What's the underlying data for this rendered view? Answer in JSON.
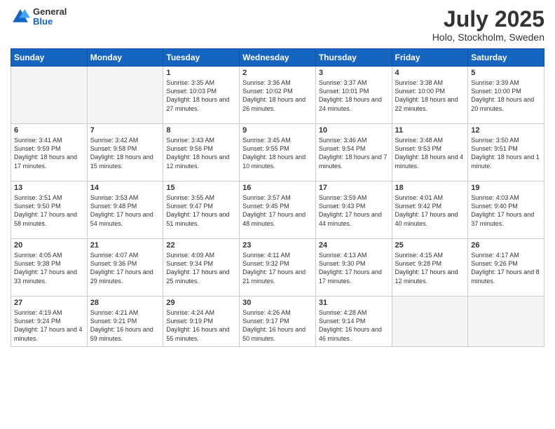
{
  "logo": {
    "general": "General",
    "blue": "Blue"
  },
  "title": "July 2025",
  "location": "Holo, Stockholm, Sweden",
  "days_of_week": [
    "Sunday",
    "Monday",
    "Tuesday",
    "Wednesday",
    "Thursday",
    "Friday",
    "Saturday"
  ],
  "weeks": [
    [
      {
        "day": "",
        "empty": true
      },
      {
        "day": "",
        "empty": true
      },
      {
        "day": "1",
        "sunrise": "Sunrise: 3:35 AM",
        "sunset": "Sunset: 10:03 PM",
        "daylight": "Daylight: 18 hours and 27 minutes."
      },
      {
        "day": "2",
        "sunrise": "Sunrise: 3:36 AM",
        "sunset": "Sunset: 10:02 PM",
        "daylight": "Daylight: 18 hours and 26 minutes."
      },
      {
        "day": "3",
        "sunrise": "Sunrise: 3:37 AM",
        "sunset": "Sunset: 10:01 PM",
        "daylight": "Daylight: 18 hours and 24 minutes."
      },
      {
        "day": "4",
        "sunrise": "Sunrise: 3:38 AM",
        "sunset": "Sunset: 10:00 PM",
        "daylight": "Daylight: 18 hours and 22 minutes."
      },
      {
        "day": "5",
        "sunrise": "Sunrise: 3:39 AM",
        "sunset": "Sunset: 10:00 PM",
        "daylight": "Daylight: 18 hours and 20 minutes."
      }
    ],
    [
      {
        "day": "6",
        "sunrise": "Sunrise: 3:41 AM",
        "sunset": "Sunset: 9:59 PM",
        "daylight": "Daylight: 18 hours and 17 minutes."
      },
      {
        "day": "7",
        "sunrise": "Sunrise: 3:42 AM",
        "sunset": "Sunset: 9:58 PM",
        "daylight": "Daylight: 18 hours and 15 minutes."
      },
      {
        "day": "8",
        "sunrise": "Sunrise: 3:43 AM",
        "sunset": "Sunset: 9:56 PM",
        "daylight": "Daylight: 18 hours and 12 minutes."
      },
      {
        "day": "9",
        "sunrise": "Sunrise: 3:45 AM",
        "sunset": "Sunset: 9:55 PM",
        "daylight": "Daylight: 18 hours and 10 minutes."
      },
      {
        "day": "10",
        "sunrise": "Sunrise: 3:46 AM",
        "sunset": "Sunset: 9:54 PM",
        "daylight": "Daylight: 18 hours and 7 minutes."
      },
      {
        "day": "11",
        "sunrise": "Sunrise: 3:48 AM",
        "sunset": "Sunset: 9:53 PM",
        "daylight": "Daylight: 18 hours and 4 minutes."
      },
      {
        "day": "12",
        "sunrise": "Sunrise: 3:50 AM",
        "sunset": "Sunset: 9:51 PM",
        "daylight": "Daylight: 18 hours and 1 minute."
      }
    ],
    [
      {
        "day": "13",
        "sunrise": "Sunrise: 3:51 AM",
        "sunset": "Sunset: 9:50 PM",
        "daylight": "Daylight: 17 hours and 58 minutes."
      },
      {
        "day": "14",
        "sunrise": "Sunrise: 3:53 AM",
        "sunset": "Sunset: 9:48 PM",
        "daylight": "Daylight: 17 hours and 54 minutes."
      },
      {
        "day": "15",
        "sunrise": "Sunrise: 3:55 AM",
        "sunset": "Sunset: 9:47 PM",
        "daylight": "Daylight: 17 hours and 51 minutes."
      },
      {
        "day": "16",
        "sunrise": "Sunrise: 3:57 AM",
        "sunset": "Sunset: 9:45 PM",
        "daylight": "Daylight: 17 hours and 48 minutes."
      },
      {
        "day": "17",
        "sunrise": "Sunrise: 3:59 AM",
        "sunset": "Sunset: 9:43 PM",
        "daylight": "Daylight: 17 hours and 44 minutes."
      },
      {
        "day": "18",
        "sunrise": "Sunrise: 4:01 AM",
        "sunset": "Sunset: 9:42 PM",
        "daylight": "Daylight: 17 hours and 40 minutes."
      },
      {
        "day": "19",
        "sunrise": "Sunrise: 4:03 AM",
        "sunset": "Sunset: 9:40 PM",
        "daylight": "Daylight: 17 hours and 37 minutes."
      }
    ],
    [
      {
        "day": "20",
        "sunrise": "Sunrise: 4:05 AM",
        "sunset": "Sunset: 9:38 PM",
        "daylight": "Daylight: 17 hours and 33 minutes."
      },
      {
        "day": "21",
        "sunrise": "Sunrise: 4:07 AM",
        "sunset": "Sunset: 9:36 PM",
        "daylight": "Daylight: 17 hours and 29 minutes."
      },
      {
        "day": "22",
        "sunrise": "Sunrise: 4:09 AM",
        "sunset": "Sunset: 9:34 PM",
        "daylight": "Daylight: 17 hours and 25 minutes."
      },
      {
        "day": "23",
        "sunrise": "Sunrise: 4:11 AM",
        "sunset": "Sunset: 9:32 PM",
        "daylight": "Daylight: 17 hours and 21 minutes."
      },
      {
        "day": "24",
        "sunrise": "Sunrise: 4:13 AM",
        "sunset": "Sunset: 9:30 PM",
        "daylight": "Daylight: 17 hours and 17 minutes."
      },
      {
        "day": "25",
        "sunrise": "Sunrise: 4:15 AM",
        "sunset": "Sunset: 9:28 PM",
        "daylight": "Daylight: 17 hours and 12 minutes."
      },
      {
        "day": "26",
        "sunrise": "Sunrise: 4:17 AM",
        "sunset": "Sunset: 9:26 PM",
        "daylight": "Daylight: 17 hours and 8 minutes."
      }
    ],
    [
      {
        "day": "27",
        "sunrise": "Sunrise: 4:19 AM",
        "sunset": "Sunset: 9:24 PM",
        "daylight": "Daylight: 17 hours and 4 minutes."
      },
      {
        "day": "28",
        "sunrise": "Sunrise: 4:21 AM",
        "sunset": "Sunset: 9:21 PM",
        "daylight": "Daylight: 16 hours and 59 minutes."
      },
      {
        "day": "29",
        "sunrise": "Sunrise: 4:24 AM",
        "sunset": "Sunset: 9:19 PM",
        "daylight": "Daylight: 16 hours and 55 minutes."
      },
      {
        "day": "30",
        "sunrise": "Sunrise: 4:26 AM",
        "sunset": "Sunset: 9:17 PM",
        "daylight": "Daylight: 16 hours and 50 minutes."
      },
      {
        "day": "31",
        "sunrise": "Sunrise: 4:28 AM",
        "sunset": "Sunset: 9:14 PM",
        "daylight": "Daylight: 16 hours and 46 minutes."
      },
      {
        "day": "",
        "empty": true
      },
      {
        "day": "",
        "empty": true
      }
    ]
  ]
}
